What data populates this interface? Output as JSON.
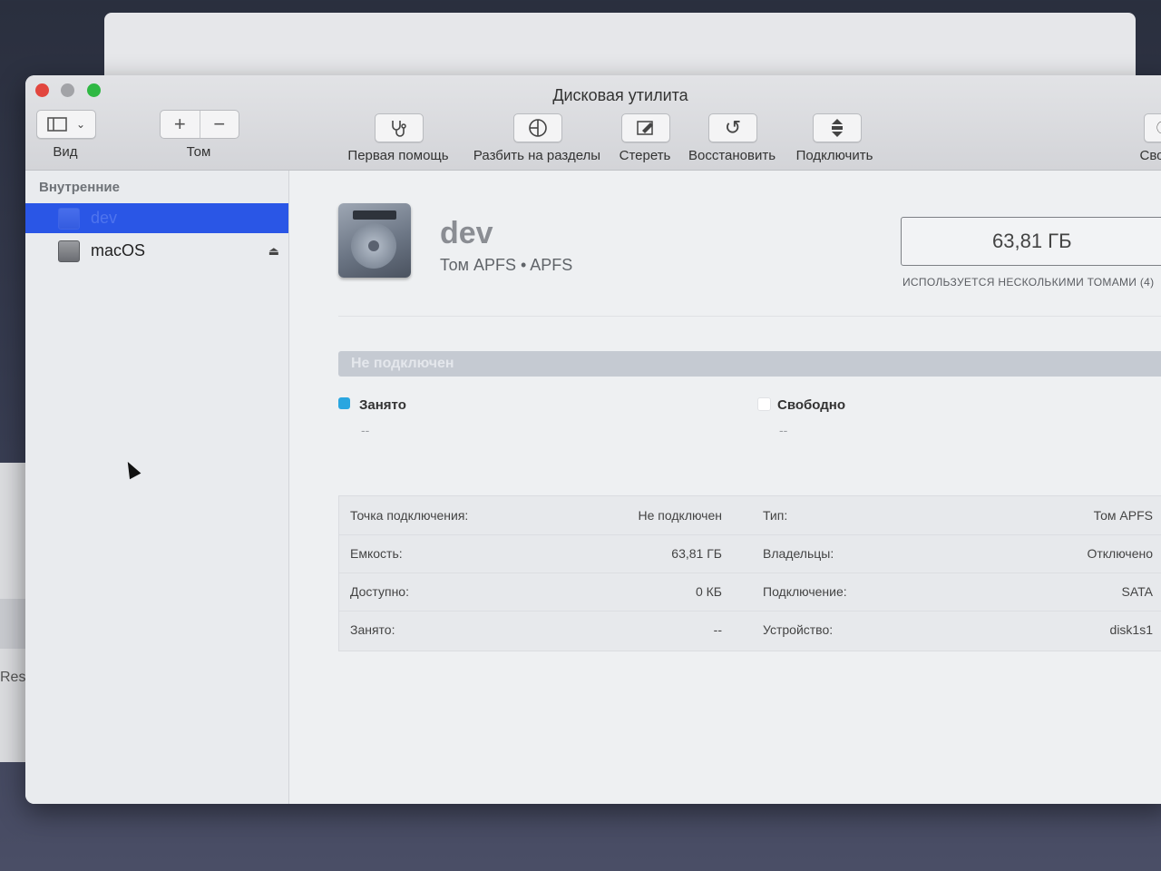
{
  "background_window": {
    "restore_text": "Restor"
  },
  "window": {
    "title": "Дисковая утилита"
  },
  "toolbar": {
    "view_label": "Вид",
    "volume_label": "Том",
    "volume_add": "+",
    "volume_remove": "−",
    "first_aid_label": "Первая помощь",
    "partition_label": "Разбить на разделы",
    "erase_label": "Стереть",
    "restore_label": "Восстановить",
    "mount_label": "Подключить",
    "info_label": "Сво"
  },
  "sidebar": {
    "section_header": "Внутренние",
    "items": [
      {
        "label": "dev",
        "selected": true
      },
      {
        "label": "macOS",
        "selected": false,
        "eject": "⏏"
      }
    ]
  },
  "volume": {
    "name": "dev",
    "subtitle": "Том APFS • APFS",
    "size": "63,81 ГБ",
    "size_caption": "ИСПОЛЬЗУЕТСЯ НЕСКОЛЬКИМИ ТОМАМИ (4)",
    "status_bar_text": "Не подключен"
  },
  "legend": {
    "used": {
      "title": "Занято",
      "value": "--",
      "color": "#2aa6e0"
    },
    "free": {
      "title": "Свободно",
      "value": "--",
      "color": "#ffffff"
    }
  },
  "info": {
    "rows": [
      {
        "left_label": "Точка подключения:",
        "left_value": "Не подключен",
        "right_label": "Тип:",
        "right_value": "Том APFS"
      },
      {
        "left_label": "Емкость:",
        "left_value": "63,81 ГБ",
        "right_label": "Владельцы:",
        "right_value": "Отключено"
      },
      {
        "left_label": "Доступно:",
        "left_value": "0 КБ",
        "right_label": "Подключение:",
        "right_value": "SATA"
      },
      {
        "left_label": "Занято:",
        "left_value": "--",
        "right_label": "Устройство:",
        "right_value": "disk1s1"
      }
    ]
  }
}
